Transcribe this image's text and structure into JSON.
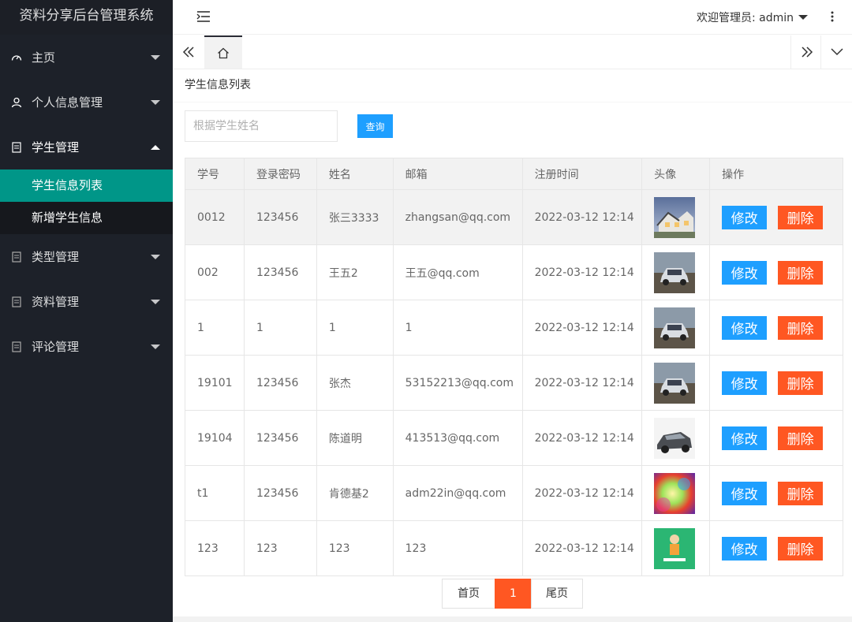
{
  "app": {
    "title": "资料分享后台管理系统"
  },
  "header": {
    "welcome": "欢迎管理员: admin"
  },
  "sidebar": {
    "items": [
      {
        "label": "主页"
      },
      {
        "label": "个人信息管理"
      },
      {
        "label": "学生管理",
        "open": true,
        "children": [
          {
            "label": "学生信息列表",
            "active": true
          },
          {
            "label": "新增学生信息"
          }
        ]
      },
      {
        "label": "类型管理"
      },
      {
        "label": "资料管理"
      },
      {
        "label": "评论管理"
      }
    ]
  },
  "page": {
    "heading": "学生信息列表"
  },
  "search": {
    "placeholder": "根据学生姓名",
    "button": "查询"
  },
  "table": {
    "columns": [
      "学号",
      "登录密码",
      "姓名",
      "邮箱",
      "注册时间",
      "头像",
      "操作"
    ],
    "rows": [
      {
        "id": "0012",
        "password": "123456",
        "name": "张三3333",
        "email": "zhangsan@qq.com",
        "time": "2022-03-12 12:14",
        "avatar": "house-photo",
        "edit": "修改",
        "del": "删除"
      },
      {
        "id": "002",
        "password": "123456",
        "name": "王五2",
        "email": "王五@qq.com",
        "time": "2022-03-12 12:14",
        "avatar": "car-photo",
        "edit": "修改",
        "del": "删除"
      },
      {
        "id": "1",
        "password": "1",
        "name": "1",
        "email": "1",
        "time": "2022-03-12 12:14",
        "avatar": "car-photo",
        "edit": "修改",
        "del": "删除"
      },
      {
        "id": "19101",
        "password": "123456",
        "name": "张杰",
        "email": "53152213@qq.com",
        "time": "2022-03-12 12:14",
        "avatar": "car-photo",
        "edit": "修改",
        "del": "删除"
      },
      {
        "id": "19104",
        "password": "123456",
        "name": "陈道明",
        "email": "413513@qq.com",
        "time": "2022-03-12 12:14",
        "avatar": "silver-car-photo",
        "edit": "修改",
        "del": "删除"
      },
      {
        "id": "t1",
        "password": "123456",
        "name": "肯德基2",
        "email": "adm22in@qq.com",
        "time": "2022-03-12 12:14",
        "avatar": "colorful-photo",
        "edit": "修改",
        "del": "删除"
      },
      {
        "id": "123",
        "password": "123",
        "name": "123",
        "email": "123",
        "time": "2022-03-12 12:14",
        "avatar": "green-logo-photo",
        "edit": "修改",
        "del": "删除"
      }
    ]
  },
  "pager": {
    "first": "首页",
    "current": "1",
    "last": "尾页"
  },
  "colors": {
    "sidebar": "#1d2129",
    "active": "#009688",
    "primary": "#1e9fff",
    "danger": "#ff5722"
  }
}
